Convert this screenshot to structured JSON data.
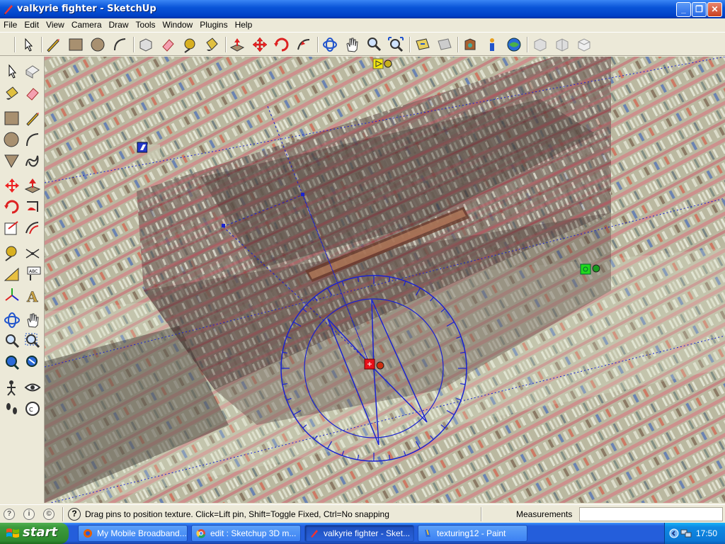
{
  "window": {
    "title": "valkyrie fighter - SketchUp"
  },
  "menu": [
    "File",
    "Edit",
    "View",
    "Camera",
    "Draw",
    "Tools",
    "Window",
    "Plugins",
    "Help"
  ],
  "status": {
    "hint": "Drag pins to position texture.  Click=Lift pin, Shift=Toggle Fixed, Ctrl=No snapping",
    "measurements_label": "Measurements",
    "measurements_value": ""
  },
  "taskbar": {
    "start": "start",
    "tasks": [
      "My Mobile Broadband...",
      "edit : Sketchup 3D m...",
      "valkyrie fighter - Sket...",
      "texturing12 - Paint"
    ],
    "clock": "17:50"
  },
  "colors": {
    "pin_red": "#E8101A",
    "pin_green": "#22D81C",
    "pin_yellow": "#F2E610",
    "pin_blue": "#2438C8",
    "guide": "#1A22D0"
  }
}
